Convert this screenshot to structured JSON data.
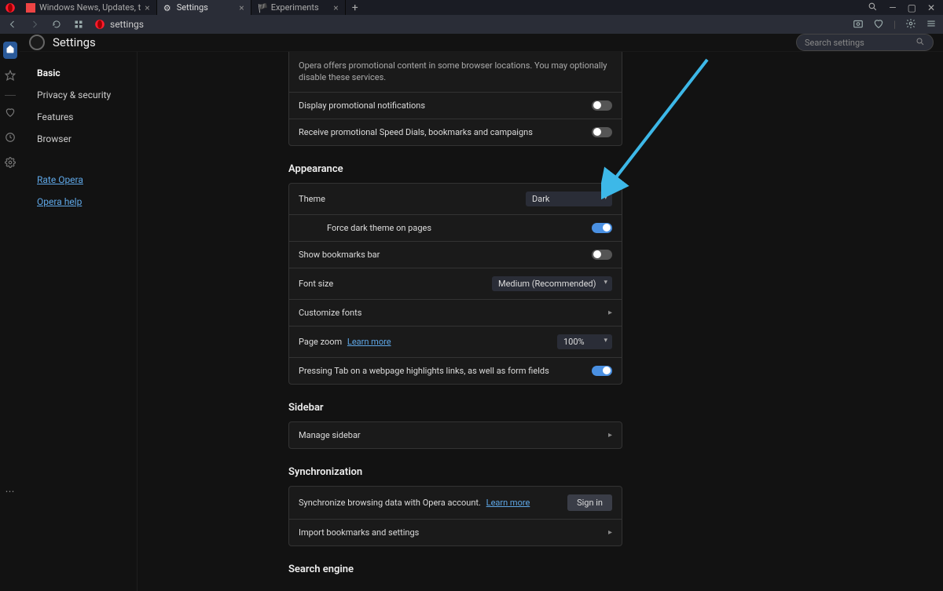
{
  "titlebar": {
    "tabs": [
      {
        "label": "Windows News, Updates, t",
        "icon": "page-icon"
      },
      {
        "label": "Settings",
        "icon": "gear-icon",
        "active": true
      },
      {
        "label": "Experiments",
        "icon": "flask-icon"
      }
    ]
  },
  "toolbar": {
    "address": "settings"
  },
  "header": {
    "title": "Settings",
    "search_placeholder": "Search settings"
  },
  "nav": {
    "items": [
      "Basic",
      "Privacy & security",
      "Features",
      "Browser"
    ],
    "links": [
      "Rate Opera",
      "Opera help"
    ]
  },
  "promo": {
    "desc": "Opera offers promotional content in some browser locations. You may optionally disable these services.",
    "display_notif": "Display promotional notifications",
    "display_notif_on": false,
    "receive_speed": "Receive promotional Speed Dials, bookmarks and campaigns",
    "receive_speed_on": false
  },
  "appearance": {
    "title": "Appearance",
    "theme_label": "Theme",
    "theme_value": "Dark",
    "force_dark": "Force dark theme on pages",
    "force_dark_on": true,
    "bookmarks_bar": "Show bookmarks bar",
    "bookmarks_bar_on": false,
    "font_label": "Font size",
    "font_value": "Medium (Recommended)",
    "customize_fonts": "Customize fonts",
    "zoom_label": "Page zoom",
    "zoom_learn": "Learn more",
    "zoom_value": "100%",
    "tab_highlight": "Pressing Tab on a webpage highlights links, as well as form fields",
    "tab_highlight_on": true
  },
  "sidebar": {
    "title": "Sidebar",
    "manage": "Manage sidebar"
  },
  "sync": {
    "title": "Synchronization",
    "desc": "Synchronize browsing data with Opera account.",
    "learn": "Learn more",
    "signin": "Sign in",
    "import": "Import bookmarks and settings"
  },
  "search": {
    "title": "Search engine"
  }
}
